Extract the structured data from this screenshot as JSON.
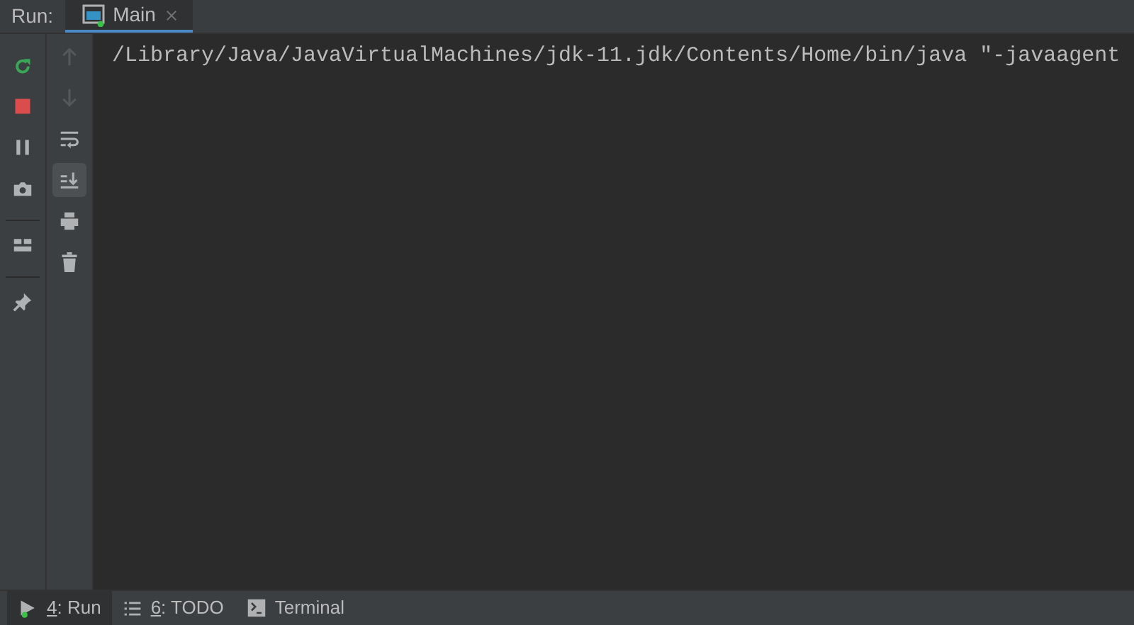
{
  "header": {
    "label": "Run:",
    "tabs": [
      {
        "label": "Main",
        "selected": true
      }
    ]
  },
  "main_toolbar": [
    {
      "kind": "rerun"
    },
    {
      "kind": "stop"
    },
    {
      "kind": "pause"
    },
    {
      "kind": "camera"
    },
    {
      "kind": "layout"
    },
    {
      "kind": "pin"
    }
  ],
  "console_toolbar": [
    {
      "kind": "up",
      "disabled": true,
      "selected": false
    },
    {
      "kind": "down",
      "disabled": true,
      "selected": false
    },
    {
      "kind": "wrap",
      "disabled": false,
      "selected": false
    },
    {
      "kind": "scroll-end",
      "disabled": false,
      "selected": true
    },
    {
      "kind": "print",
      "disabled": false,
      "selected": false
    },
    {
      "kind": "trash",
      "disabled": false,
      "selected": false
    }
  ],
  "console": {
    "lines": [
      "/Library/Java/JavaVirtualMachines/jdk-11.jdk/Contents/Home/bin/java \"-javaagent"
    ]
  },
  "bottom_tabs": [
    {
      "kind": "run",
      "mnemonic": "4",
      "label": ": Run",
      "selected": true
    },
    {
      "kind": "todo",
      "mnemonic": "6",
      "label": ": TODO",
      "selected": false
    },
    {
      "kind": "terminal",
      "label": "Terminal",
      "selected": false
    }
  ]
}
